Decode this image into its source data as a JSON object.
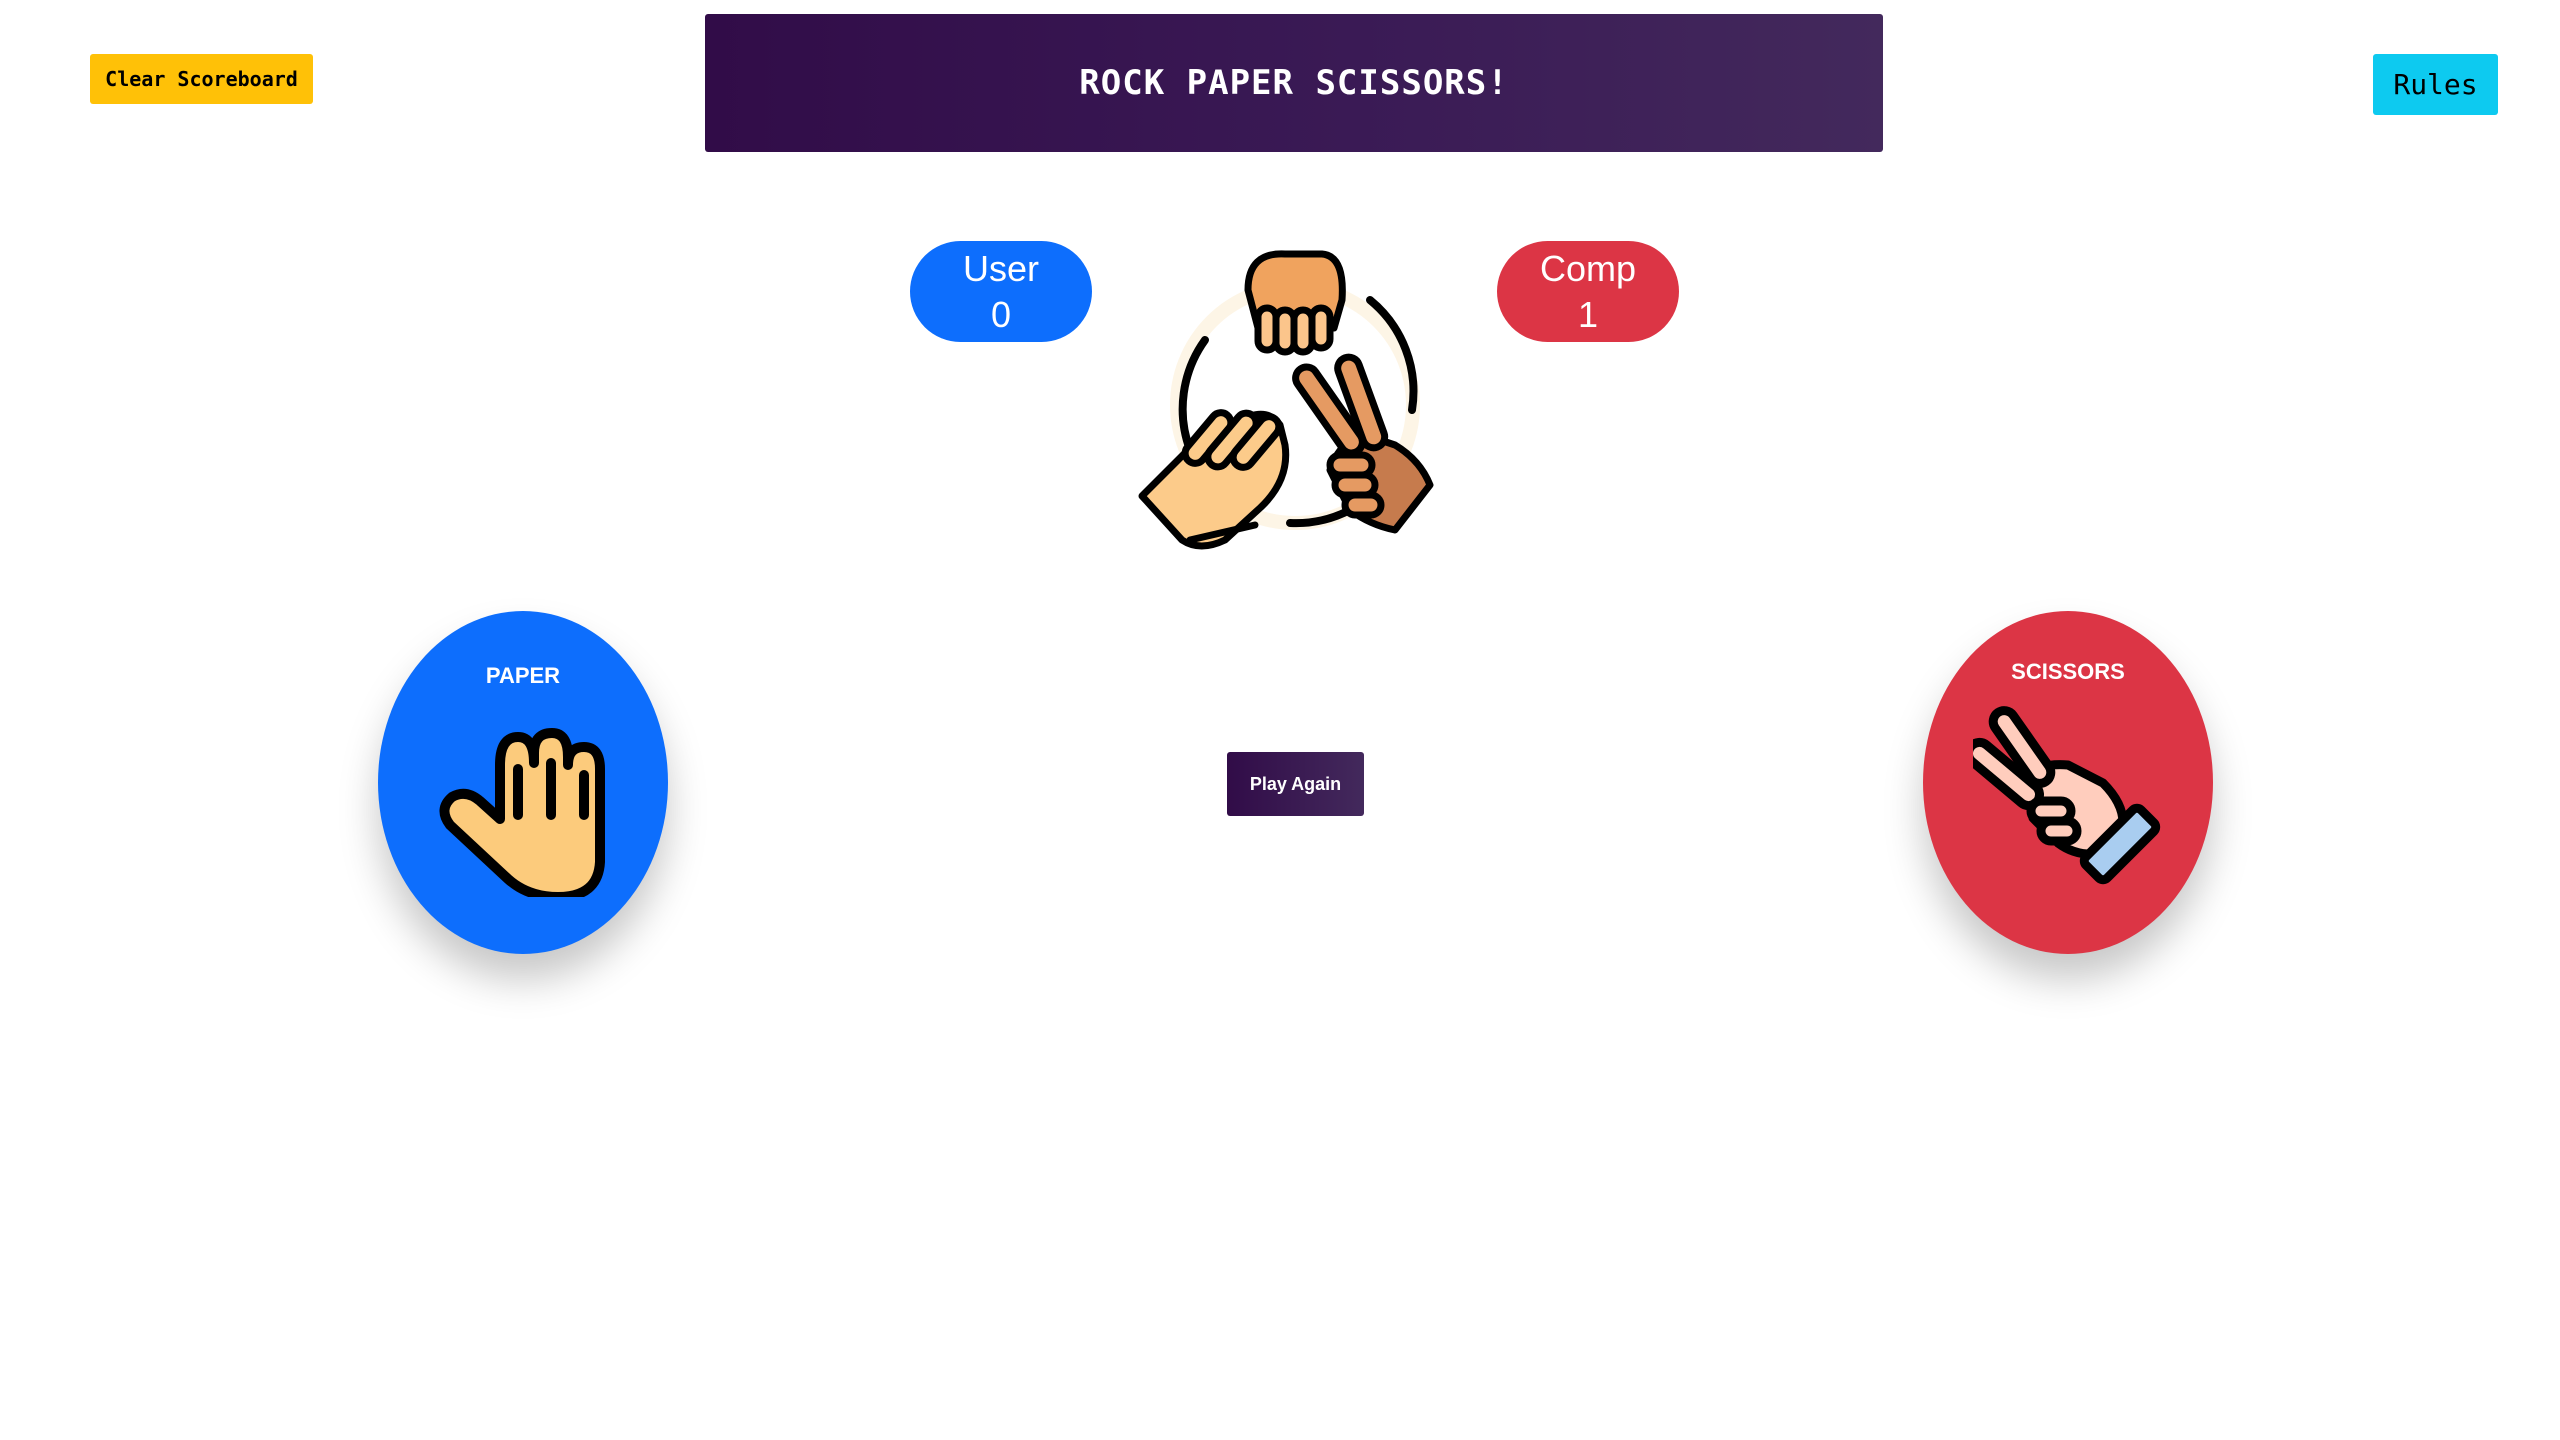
{
  "toolbar": {
    "clear_label": "Clear Scoreboard",
    "rules_label": "Rules"
  },
  "header": {
    "title": "ROCK PAPER SCISSORS!"
  },
  "scoreboard": {
    "user": {
      "label": "User",
      "score": "0"
    },
    "comp": {
      "label": "Comp",
      "score": "1"
    }
  },
  "logo": {
    "icon": "rock-paper-scissors-hands-icon"
  },
  "result": {
    "user_choice": {
      "label": "PAPER",
      "icon": "open-hand-icon"
    },
    "comp_choice": {
      "label": "SCISSORS",
      "icon": "peace-hand-icon"
    }
  },
  "actions": {
    "play_again_label": "Play Again"
  },
  "colors": {
    "user": "#0d6efd",
    "comp": "#dc3545",
    "banner_start": "#310c48",
    "banner_end": "#43295c",
    "clear_button": "#ffc107",
    "rules_button": "#0dcaf0"
  }
}
